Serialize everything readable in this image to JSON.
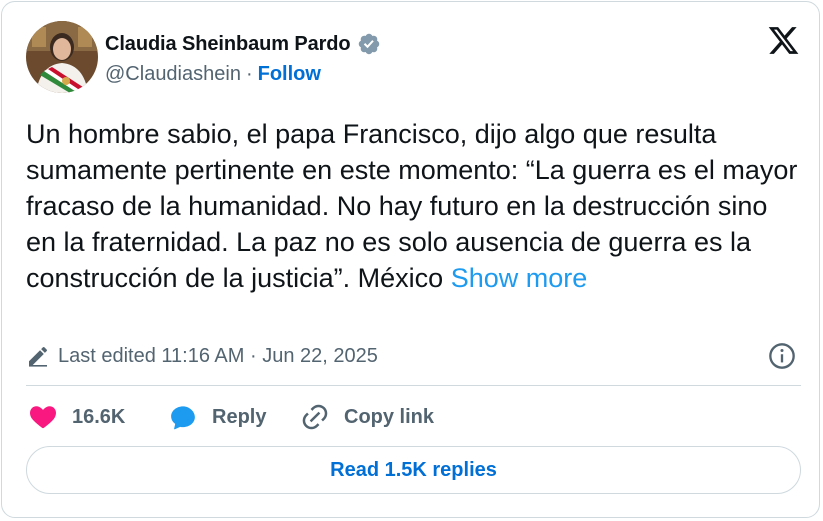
{
  "author": {
    "name": "Claudia Sheinbaum Pardo",
    "handle": "@Claudiashein",
    "separator": "·",
    "follow_label": "Follow",
    "verified_color": "#829aab"
  },
  "tweet": {
    "text": "Un hombre sabio, el papa Francisco, dijo algo que resulta sumamente pertinente en este momento: “La guerra es el mayor fracaso de la humanidad. No hay futuro en la destrucción sino en la fraternidad. La paz no es solo ausencia de guerra es la construcción de la justicia”. México",
    "show_more_label": "Show more"
  },
  "meta": {
    "edited_label": "Last edited 11:16 AM · Jun 22, 2025"
  },
  "actions": {
    "like_count": "16.6K",
    "like_color": "#f91880",
    "reply_label": "Reply",
    "reply_color": "#1d9bf0",
    "copy_link_label": "Copy link"
  },
  "footer": {
    "read_replies_label": "Read 1.5K replies"
  },
  "icons": {
    "logo": "x-logo-icon",
    "verified": "verified-badge-icon",
    "edit": "pencil-icon",
    "info": "info-icon",
    "like": "heart-icon",
    "reply": "speech-bubble-icon",
    "copy": "link-icon"
  }
}
